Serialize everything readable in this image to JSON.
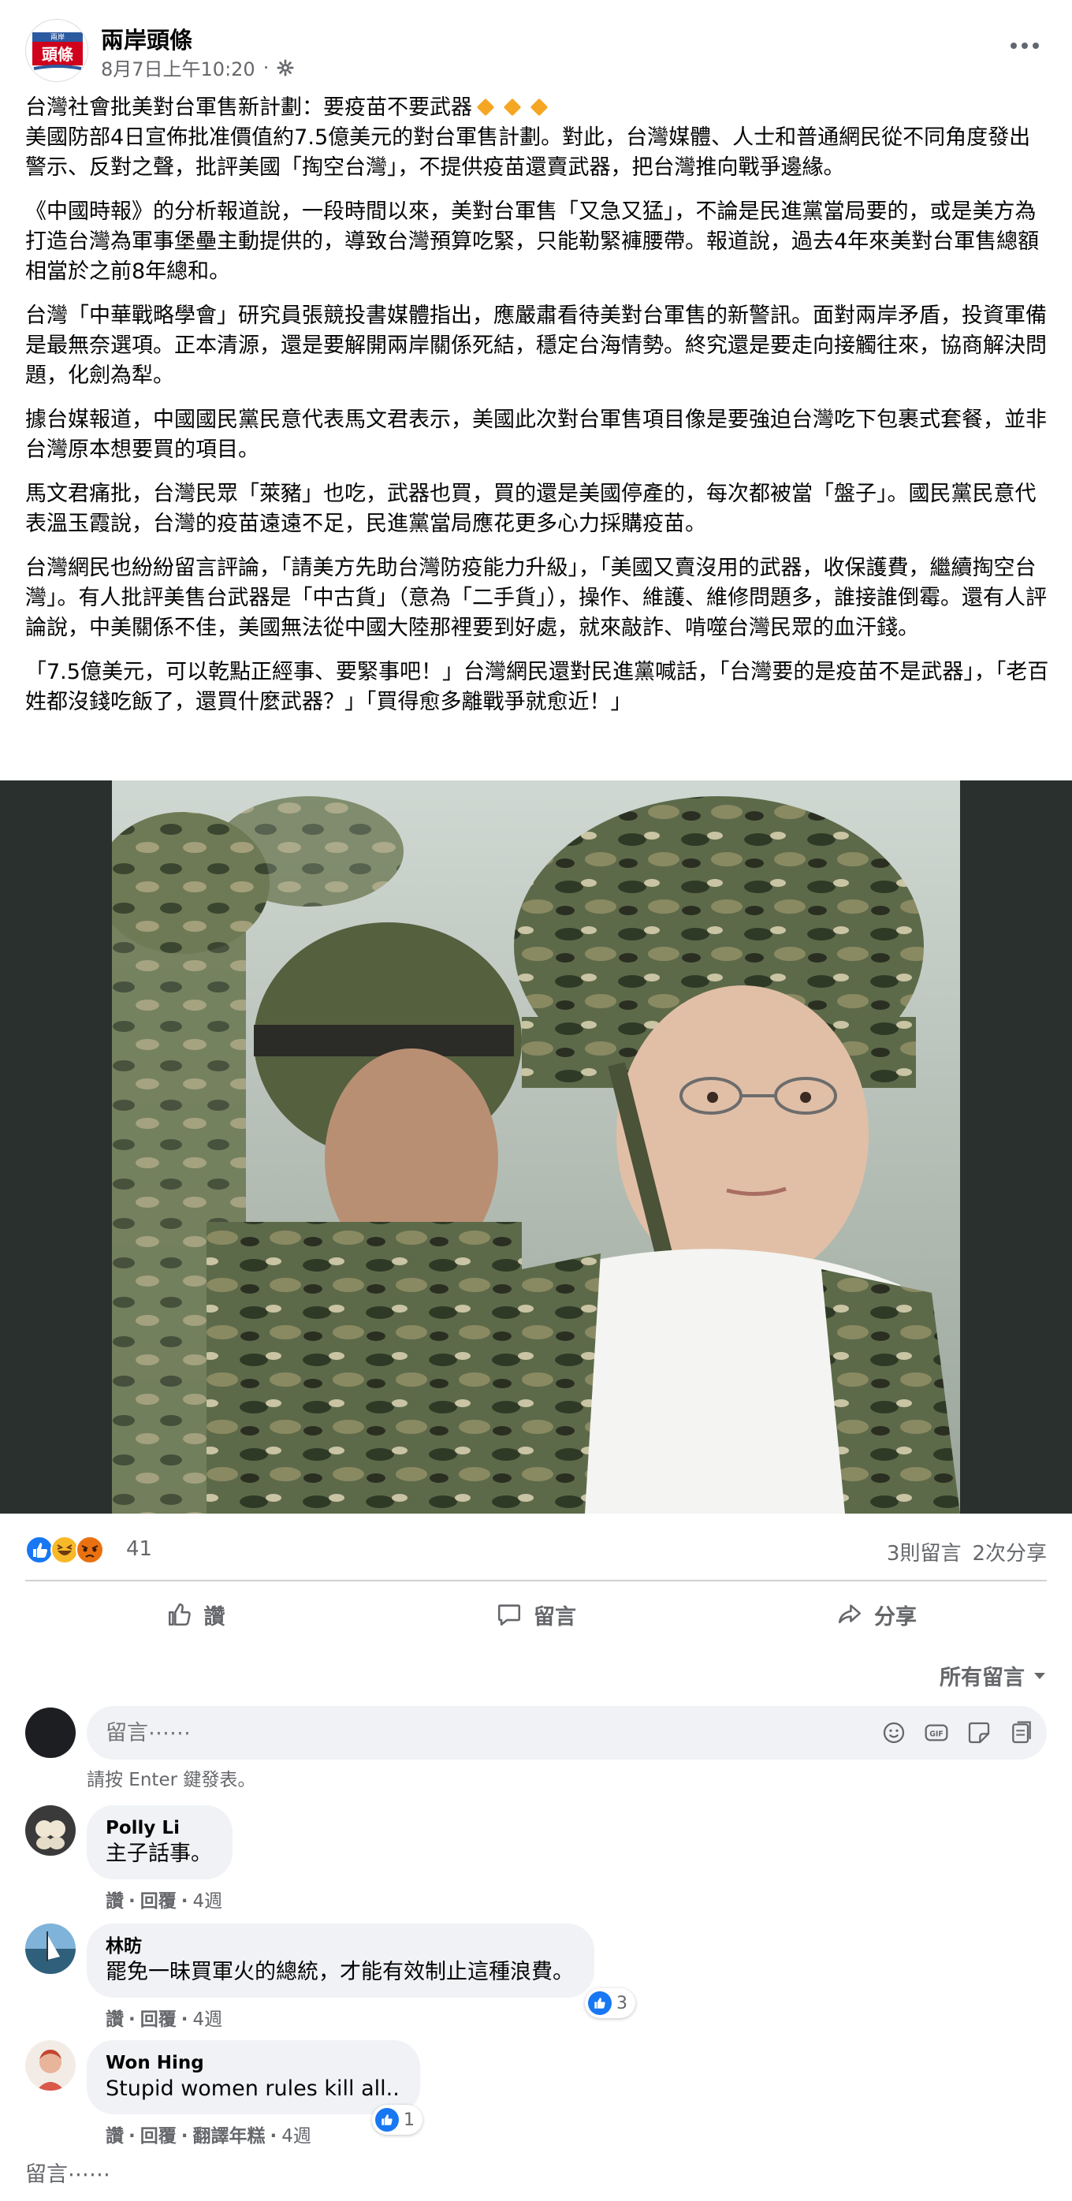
{
  "page": {
    "name": "兩岸頭條",
    "logo_text_top": "兩岸",
    "logo_text_main": "頭條",
    "timestamp": "8月7日上午10:20",
    "separator": "·",
    "privacy_icon": "gear-icon"
  },
  "post": {
    "headline": "台灣社會批美對台軍售新計劃：要疫苗不要武器",
    "paragraphs": [
      "美國防部4日宣佈批准價值約7.5億美元的對台軍售計劃。對此，台灣媒體、人士和普通網民從不同角度發出警示、反對之聲，批評美國「掏空台灣」，不提供疫苗還賣武器，把台灣推向戰爭邊緣。",
      "《中國時報》的分析報道說，一段時間以來，美對台軍售「又急又猛」，不論是民進黨當局要的，或是美方為打造台灣為軍事堡壘主動提供的，導致台灣預算吃緊，只能勒緊褲腰帶。報道說，過去4年來美對台軍售總額相當於之前8年總和。",
      "台灣「中華戰略學會」研究員張競投書媒體指出，應嚴肅看待美對台軍售的新警訊。面對兩岸矛盾，投資軍備是最無奈選項。正本清源，還是要解開兩岸關係死結，穩定台海情勢。終究還是要走向接觸往來，協商解決問題，化劍為犁。",
      "據台媒報道，中國國民黨民意代表馬文君表示，美國此次對台軍售項目像是要強迫台灣吃下包裹式套餐，並非台灣原本想要買的項目。",
      "馬文君痛批，台灣民眾「萊豬」也吃，武器也買，買的還是美國停產的，每次都被當「盤子」。國民黨民意代表溫玉霞說，台灣的疫苗遠遠不足，民進黨當局應花更多心力採購疫苗。",
      "台灣網民也紛紛留言評論，「請美方先助台灣防疫能力升級」，「美國又賣沒用的武器，收保護費，繼續掏空台灣」。有人批評美售台武器是「中古貨」（意為「二手貨」），操作、維護、維修問題多，誰接誰倒霉。還有人評論說，中美關係不佳，美國無法從中國大陸那裡要到好處，就來敲詐、啃噬台灣民眾的血汗錢。",
      "「7.5億美元，可以乾點正經事、要緊事吧！」台灣網民還對民進黨喊話，「台灣要的是疫苗不是武器」，「老百姓都沒錢吃飯了，還買什麼武器？」「買得愈多離戰爭就愈近！」"
    ],
    "image_description_icon": "photo"
  },
  "stats": {
    "reaction_count": "41",
    "comments": "3則留言",
    "shares": "2次分享"
  },
  "actions": {
    "like": "讚",
    "comment": "留言",
    "share": "分享"
  },
  "comments_section": {
    "sort_label": "所有留言",
    "input_placeholder": "留言⋯⋯",
    "hint": "請按 Enter 鍵發表。",
    "bottom_placeholder": "留言⋯⋯",
    "items": [
      {
        "author": "Polly Li",
        "text": "主子話事。",
        "like": "讚",
        "reply": "回覆",
        "time": "4週"
      },
      {
        "author": "林昉",
        "text": "罷免一昧買軍火的總統，才能有效制止這種浪費。",
        "like": "讚",
        "reply": "回覆",
        "time": "4週",
        "likes": "3"
      },
      {
        "author": "Won Hing",
        "text": "Stupid women rules kill all..",
        "like": "讚",
        "reply": "回覆",
        "translate": "翻譯年糕",
        "time": "4週",
        "likes": "1"
      }
    ]
  },
  "colors": {
    "secondary_text": "#65676b",
    "bubble_bg": "#f0f2f5",
    "like_blue": "#1877f2",
    "accent_orange": "#f5a623"
  }
}
